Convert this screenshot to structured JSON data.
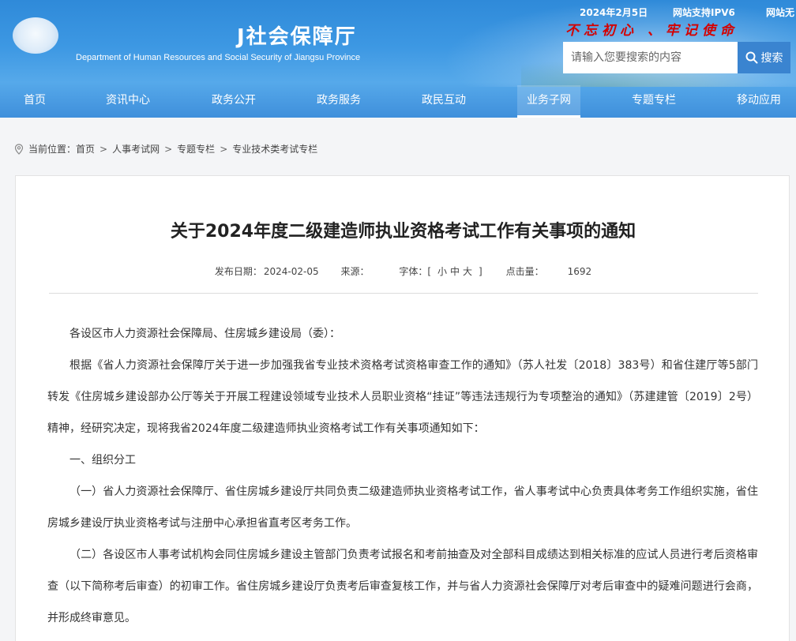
{
  "header": {
    "site_name_cn": "J社会保障厅",
    "site_name_en": "Department of Human Resources and Social Security of Jiangsu Province",
    "date": "2024年2月5日",
    "ipv6": "网站支持IPV6",
    "extra": "网站无",
    "slogan": "不忘初心 、牢记使命",
    "search": {
      "placeholder": "请输入您要搜索的内容",
      "button_label": "搜索"
    }
  },
  "nav": {
    "items": [
      {
        "label": "首页"
      },
      {
        "label": "资讯中心"
      },
      {
        "label": "政务公开"
      },
      {
        "label": "政务服务"
      },
      {
        "label": "政民互动"
      },
      {
        "label": "业务子网"
      },
      {
        "label": "专题专栏"
      },
      {
        "label": "移动应用"
      }
    ],
    "active_index": 5
  },
  "breadcrumb": {
    "prefix": "当前位置：",
    "items": [
      "首页",
      "人事考试网",
      "专题专栏",
      "专业技术类考试专栏"
    ],
    "separator": ">"
  },
  "article": {
    "title": "关于2024年度二级建造师执业资格考试工作有关事项的通知",
    "meta": {
      "date_label": "发布日期：",
      "date": "2024-02-05",
      "source_label": "来源：",
      "font_label": "字体：[",
      "font_small": "小",
      "font_medium": "中",
      "font_large": "大",
      "font_close": "]",
      "hits_label": "点击量：",
      "hits": "1692"
    },
    "paragraphs": [
      "各设区市人力资源社会保障局、住房城乡建设局（委）：",
      "根据《省人力资源社会保障厅关于进一步加强我省专业技术资格考试资格审查工作的通知》（苏人社发〔2018〕383号）和省住建厅等5部门转发《住房城乡建设部办公厅等关于开展工程建设领域专业技术人员职业资格“挂证”等违法违规行为专项整治的通知》（苏建建管〔2019〕2号）精神，经研究决定，现将我省2024年度二级建造师执业资格考试工作有关事项通知如下：",
      "一、组织分工",
      "（一）省人力资源社会保障厅、省住房城乡建设厅共同负责二级建造师执业资格考试工作，省人事考试中心负责具体考务工作组织实施，省住房城乡建设厅执业资格考试与注册中心承担省直考区考务工作。",
      "（二）各设区市人事考试机构会同住房城乡建设主管部门负责考试报名和考前抽查及对全部科目成绩达到相关标准的应试人员进行考后资格审查（以下简称考后审查）的初审工作。省住房城乡建设厅负责考后审查复核工作，并与省人力资源社会保障厅对考后审查中的疑难问题进行会商，并形成终审意见。"
    ]
  }
}
